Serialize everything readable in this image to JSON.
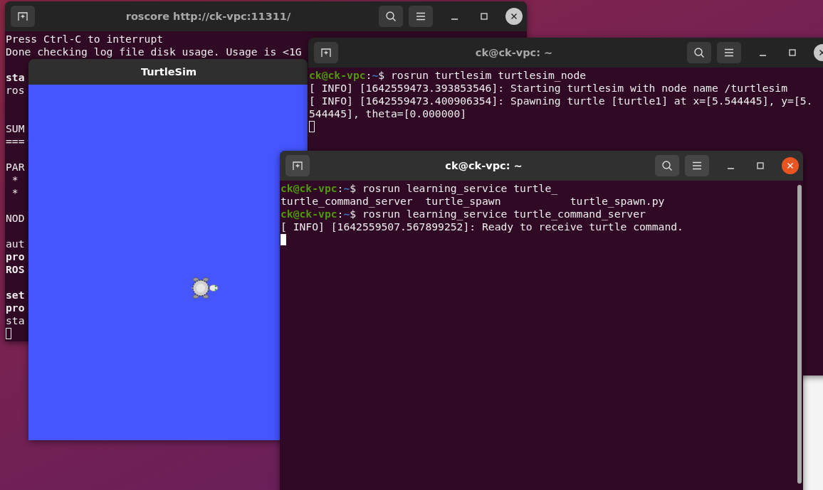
{
  "windows": [
    {
      "kind": "terminal",
      "title": "roscore http://ck-vpc:11311/",
      "active": false,
      "lines": [
        {
          "kind": "output",
          "text": "Press Ctrl-C to interrupt",
          "bold": false
        },
        {
          "kind": "output",
          "text": "Done checking log file disk usage. Usage is <1G",
          "bold": false
        },
        {
          "kind": "blank"
        },
        {
          "kind": "output",
          "text": "sta",
          "bold": true
        },
        {
          "kind": "output",
          "text": "ros",
          "bold": false
        },
        {
          "kind": "blank"
        },
        {
          "kind": "blank"
        },
        {
          "kind": "output",
          "text": "SUM",
          "bold": false
        },
        {
          "kind": "output",
          "text": "===",
          "bold": false
        },
        {
          "kind": "blank"
        },
        {
          "kind": "output",
          "text": "PAR",
          "bold": false
        },
        {
          "kind": "output",
          "text": " *",
          "bold": false
        },
        {
          "kind": "output",
          "text": " *",
          "bold": false
        },
        {
          "kind": "blank"
        },
        {
          "kind": "output",
          "text": "NOD",
          "bold": false
        },
        {
          "kind": "blank"
        },
        {
          "kind": "output",
          "text": "aut",
          "bold": false
        },
        {
          "kind": "output",
          "text": "pro",
          "bold": true
        },
        {
          "kind": "output",
          "text": "ROS",
          "bold": true
        },
        {
          "kind": "blank"
        },
        {
          "kind": "output",
          "text": "set",
          "bold": true
        },
        {
          "kind": "output",
          "text": "pro",
          "bold": true
        },
        {
          "kind": "output",
          "text": "sta",
          "bold": false
        }
      ]
    },
    {
      "kind": "turtlesim",
      "title": "TurtleSim"
    },
    {
      "kind": "terminal",
      "title": "ck@ck-vpc: ~",
      "active": false,
      "lines": [
        {
          "kind": "prompt",
          "user": "ck@ck-vpc",
          "sep": ":",
          "path": "~",
          "command": "$ rosrun turtlesim turtlesim_node"
        },
        {
          "kind": "output",
          "text": "[ INFO] [1642559473.393853546]: Starting turtlesim with node name /turtlesim",
          "bold": false
        },
        {
          "kind": "output",
          "text": "[ INFO] [1642559473.400906354]: Spawning turtle [turtle1] at x=[5.544445], y=[5.",
          "bold": false
        },
        {
          "kind": "output",
          "text": "544445], theta=[0.000000]",
          "bold": false
        }
      ]
    },
    {
      "kind": "terminal",
      "title": "ck@ck-vpc: ~",
      "active": true,
      "lines": [
        {
          "kind": "prompt",
          "user": "ck@ck-vpc",
          "sep": ":",
          "path": "~",
          "command": "$ rosrun learning_service turtle_"
        },
        {
          "kind": "output",
          "text": "turtle_command_server  turtle_spawn           turtle_spawn.py",
          "bold": false
        },
        {
          "kind": "prompt",
          "user": "ck@ck-vpc",
          "sep": ":",
          "path": "~",
          "command": "$ rosrun learning_service turtle_command_server"
        },
        {
          "kind": "output",
          "text": "[ INFO] [1642559507.567899252]: Ready to receive turtle command.",
          "bold": false
        }
      ]
    }
  ]
}
